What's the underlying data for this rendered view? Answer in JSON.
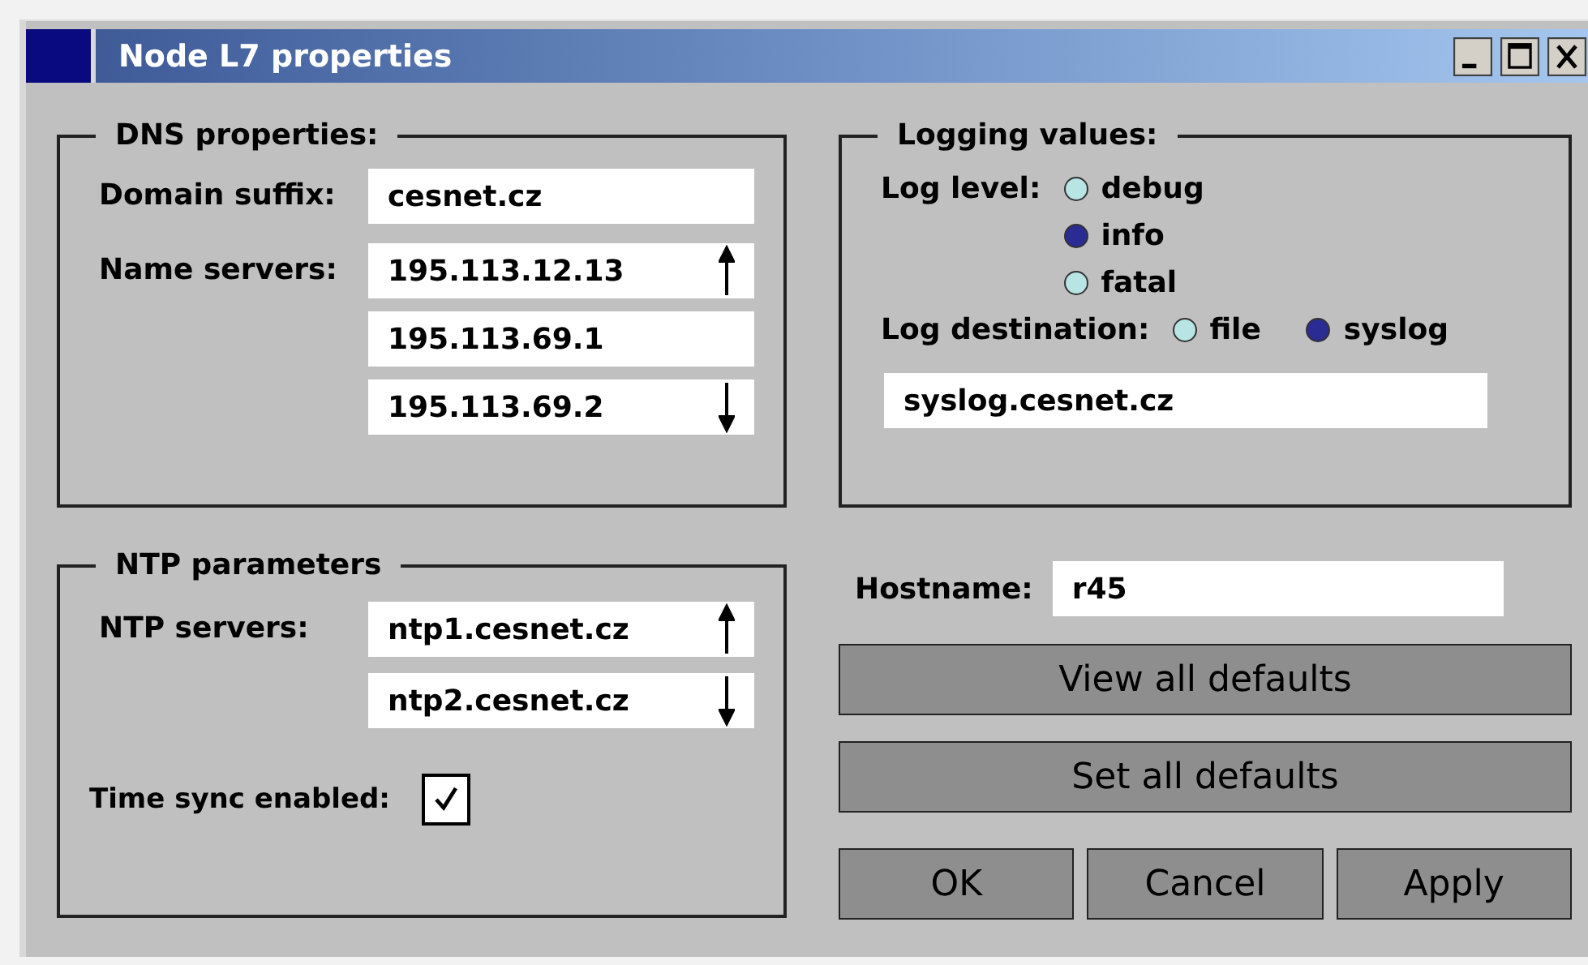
{
  "window": {
    "title": "Node L7 properties"
  },
  "dns": {
    "title": "DNS properties:",
    "domain_suffix": {
      "label": "Domain suffix:",
      "value": "cesnet.cz"
    },
    "name_servers": {
      "label": "Name servers:",
      "values": [
        "195.113.12.13",
        "195.113.69.1",
        "195.113.69.2"
      ]
    }
  },
  "ntp": {
    "title": "NTP parameters",
    "servers": {
      "label": "NTP servers:",
      "values": [
        "ntp1.cesnet.cz",
        "ntp2.cesnet.cz"
      ]
    },
    "time_sync": {
      "label": "Time sync enabled:",
      "checked": true
    }
  },
  "logging": {
    "title": "Logging values:",
    "log_level": {
      "label": "Log level:",
      "options": [
        {
          "label": "debug",
          "selected": false
        },
        {
          "label": "info",
          "selected": true
        },
        {
          "label": "fatal",
          "selected": false
        }
      ]
    },
    "log_destination": {
      "label": "Log destination:",
      "options": [
        {
          "label": "file",
          "selected": false
        },
        {
          "label": "syslog",
          "selected": true
        }
      ]
    },
    "target": {
      "value": "syslog.cesnet.cz"
    }
  },
  "hostname": {
    "label": "Hostname:",
    "value": "r45"
  },
  "wide_buttons": [
    "View all defaults",
    "Set all defaults"
  ],
  "dialog_buttons": [
    "OK",
    "Cancel",
    "Apply"
  ]
}
